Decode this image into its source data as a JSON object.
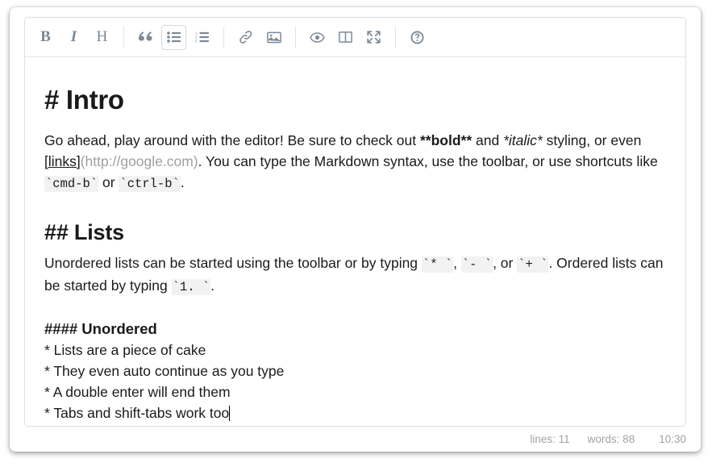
{
  "toolbar": {
    "buttons": [
      {
        "name": "bold-button",
        "glyph": "B",
        "label": "Bold",
        "type": "letter",
        "active": false
      },
      {
        "name": "italic-button",
        "glyph": "I",
        "label": "Italic",
        "type": "letter",
        "active": false
      },
      {
        "name": "heading-button",
        "glyph": "H",
        "label": "Heading",
        "type": "letter",
        "active": false
      },
      {
        "name": "quote-button",
        "glyph": "quote-icon",
        "label": "Quote",
        "type": "icon",
        "active": false
      },
      {
        "name": "unordered-list-button",
        "glyph": "unordered-list-icon",
        "label": "Generic List",
        "type": "icon",
        "active": true
      },
      {
        "name": "ordered-list-button",
        "glyph": "ordered-list-icon",
        "label": "Numbered List",
        "type": "icon",
        "active": false
      },
      {
        "name": "link-button",
        "glyph": "link-icon",
        "label": "Create Link",
        "type": "icon",
        "active": false
      },
      {
        "name": "image-button",
        "glyph": "image-icon",
        "label": "Insert Image",
        "type": "icon",
        "active": false
      },
      {
        "name": "preview-button",
        "glyph": "eye-icon",
        "label": "Toggle Preview",
        "type": "icon",
        "active": false
      },
      {
        "name": "side-by-side-button",
        "glyph": "columns-icon",
        "label": "Toggle Side by Side",
        "type": "icon",
        "active": false
      },
      {
        "name": "fullscreen-button",
        "glyph": "fullscreen-icon",
        "label": "Toggle Fullscreen",
        "type": "icon",
        "active": false
      },
      {
        "name": "guide-button",
        "glyph": "question-icon",
        "label": "Markdown Guide",
        "type": "icon",
        "active": false
      }
    ]
  },
  "document": {
    "heading1": "# Intro",
    "paragraph1": {
      "part1": "Go ahead, play around with the editor! Be sure to check out ",
      "bold": "**bold**",
      "part2": " and ",
      "italic": "*italic*",
      "part3": " styling, or even ",
      "link_text": "[links]",
      "link_url": "(http://google.com)",
      "part4": ". You can type the Markdown syntax, use the toolbar, or use shortcuts like ",
      "code1": "`cmd-b`",
      "part5": " or ",
      "code2": "`ctrl-b`",
      "part6": "."
    },
    "heading2": "## Lists",
    "paragraph2": {
      "part1": "Unordered lists can be started using the toolbar or by typing ",
      "code1": "`* `",
      "part2": ", ",
      "code2": "`- `",
      "part3": ", or ",
      "code3": "`+ `",
      "part4": ". Ordered lists can be started by typing ",
      "code4": "`1. `",
      "part5": "."
    },
    "heading4": "#### Unordered",
    "list_items": [
      "* Lists are a piece of cake",
      "* They even auto continue as you type",
      "* A double enter will end them",
      "* Tabs and shift-tabs work too"
    ]
  },
  "statusbar": {
    "lines": "lines: 11",
    "words": "words: 88",
    "time": "10:30"
  },
  "colors": {
    "toolbar_icon": "#7b8a97",
    "text": "#1a1a1a",
    "url_gray": "#a0a0a0",
    "code_background": "#f2f2f2",
    "status_text": "#a3a3a3",
    "border": "#dfdfdf"
  }
}
